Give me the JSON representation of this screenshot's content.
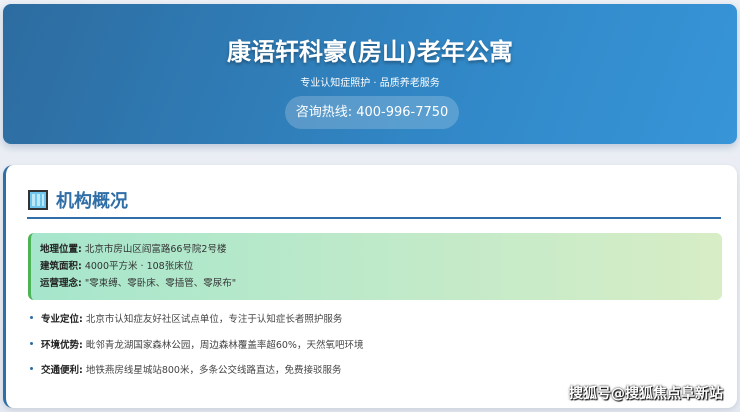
{
  "header": {
    "title": "康语轩科豪(房山)老年公寓",
    "subtitle": "专业认知症照护 · 品质养老服务",
    "hotline": "咨询热线: 400-996-7750"
  },
  "section": {
    "icon": "office-building-icon",
    "title": "机构概况",
    "info": [
      {
        "label": "地理位置:",
        "value": " 北京市房山区阎富路66号院2号楼"
      },
      {
        "label": "建筑面积:",
        "value": " 4000平方米 · 108张床位"
      },
      {
        "label": "运营理念:",
        "value": " \"零束缚、零卧床、零插管、零尿布\""
      }
    ],
    "bullets": [
      {
        "label": "专业定位:",
        "value": " 北京市认知症友好社区试点单位，专注于认知症长者照护服务"
      },
      {
        "label": "环境优势:",
        "value": " 毗邻青龙湖国家森林公园，周边森林覆盖率超60%，天然氧吧环境"
      },
      {
        "label": "交通便利:",
        "value": " 地铁燕房线星城站800米，多条公交线路直达，免费接驳服务"
      }
    ]
  },
  "watermark": "搜狐号@搜狐焦点阜新站"
}
